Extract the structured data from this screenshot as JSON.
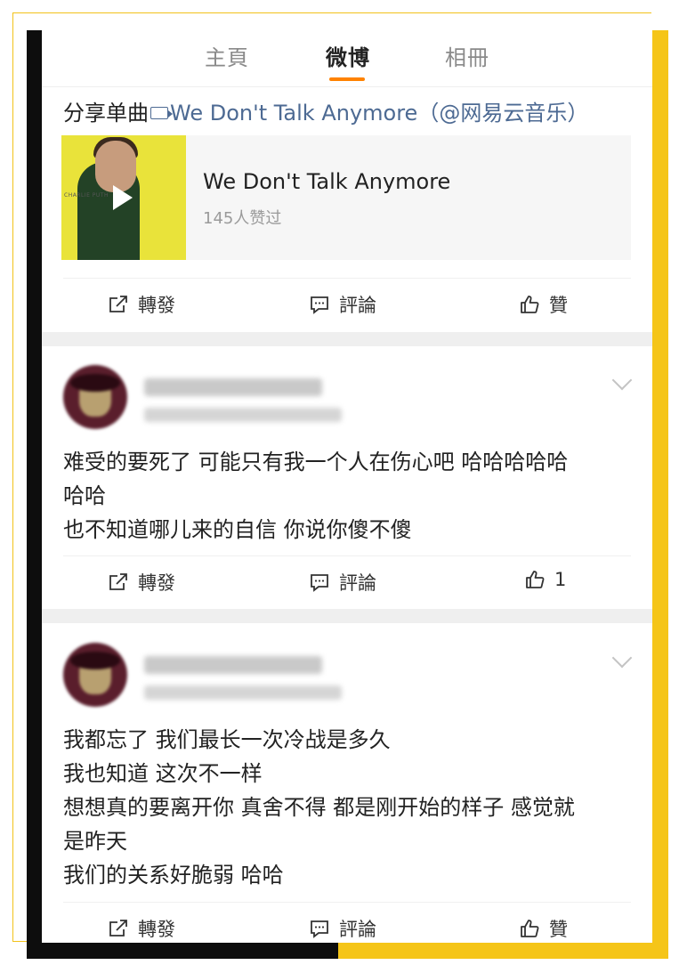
{
  "tabs": [
    {
      "label": "主頁"
    },
    {
      "label": "微博"
    },
    {
      "label": "相冊"
    }
  ],
  "active_tab_color": "#ff8200",
  "post": {
    "prefix": "分享单曲",
    "link_icon": "link-play-icon",
    "song_link": "We Don't Talk Anymore",
    "source": "（@网易云音乐）",
    "card": {
      "title": "We Don't Talk Anymore",
      "likes": "145人赞过",
      "album_artist_text": "CHARLIE PUTH",
      "album_color": "#e9e33a"
    },
    "actions": {
      "repost": "轉發",
      "comment": "評論",
      "like": "贊"
    }
  },
  "comments": [
    {
      "lines": [
        "难受的要死了 可能只有我一个人在伤心吧 哈哈哈哈哈",
        "哈哈",
        "也不知道哪儿来的自信 你说你傻不傻"
      ],
      "actions": {
        "repost": "轉發",
        "comment": "評論",
        "like": "1"
      }
    },
    {
      "lines": [
        "我都忘了 我们最长一次冷战是多久",
        "我也知道 这次不一样",
        "想想真的要离开你 真舍不得 都是刚开始的样子 感觉就",
        "是昨天",
        "我们的关系好脆弱  哈哈"
      ],
      "actions": {
        "repost": "轉發",
        "comment": "評論",
        "like": "贊"
      }
    }
  ],
  "colors": {
    "link": "#4d6a93",
    "frame_yellow": "#f5c518",
    "frame_black": "#0d0d0d"
  }
}
